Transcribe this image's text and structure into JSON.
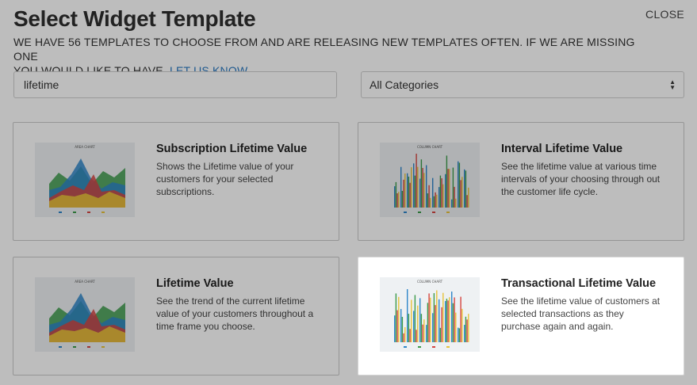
{
  "header": {
    "title": "Select Widget Template",
    "close_label": "CLOSE",
    "intro_line1": "WE HAVE 56 TEMPLATES TO CHOOSE FROM AND ARE RELEASING NEW TEMPLATES OFTEN. IF WE ARE MISSING ONE",
    "intro_line2_prefix": "YOU WOULD LIKE TO HAVE, ",
    "intro_link": "LET US KNOW",
    "intro_line2_suffix": "."
  },
  "filters": {
    "search_value": "lifetime",
    "category_selected": "All Categories"
  },
  "templates": [
    {
      "title": "Subscription Lifetime Value",
      "description": "Shows the Lifetime value of your customers for your selected subscriptions.",
      "thumbnail": "area-chart",
      "thumb_title": "AREA CHART",
      "highlighted": false
    },
    {
      "title": "Interval Lifetime Value",
      "description": "See the lifetime value at various time intervals of your choosing through out the customer life cycle.",
      "thumbnail": "column-chart",
      "thumb_title": "COLUMN CHART",
      "highlighted": false
    },
    {
      "title": "Lifetime Value",
      "description": "See the trend of the current lifetime value of your customers throughout a time frame you choose.",
      "thumbnail": "area-chart",
      "thumb_title": "AREA CHART",
      "highlighted": false
    },
    {
      "title": "Transactional Lifetime Value",
      "description": "See the lifetime value of customers at selected transactions as they purchase again and again.",
      "thumbnail": "column-chart",
      "thumb_title": "COLUMN CHART",
      "highlighted": true
    }
  ],
  "colors": {
    "link": "#2a78c0",
    "series_blue": "#2e86c9",
    "series_green": "#3c9b4a",
    "series_red": "#d64541",
    "series_yellow": "#e8c33a"
  }
}
